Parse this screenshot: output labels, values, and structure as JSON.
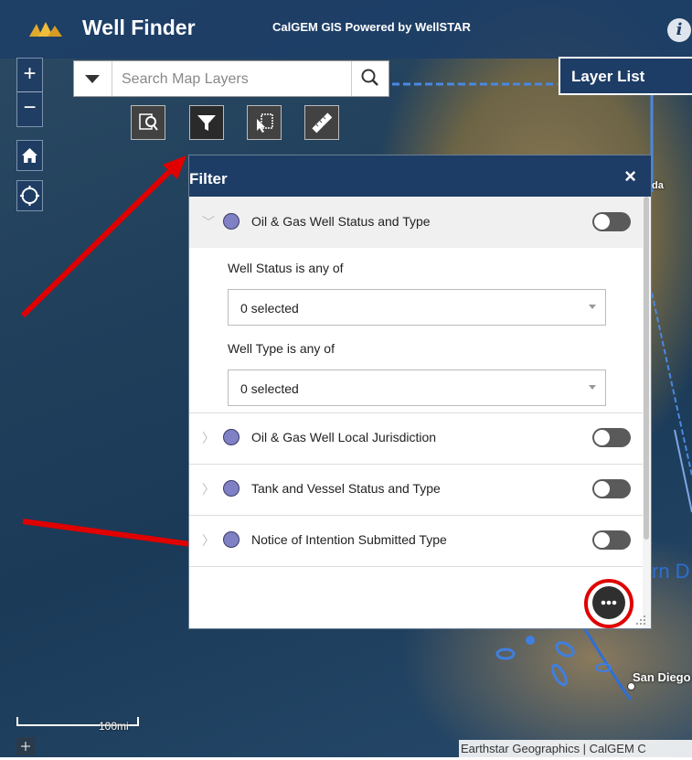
{
  "header": {
    "title": "Well Finder",
    "subtitle": "CalGEM GIS Powered by WellSTAR",
    "info_icon": "i"
  },
  "map_controls": {
    "zoom_in": "+",
    "zoom_out": "−",
    "home_icon": "home-icon",
    "locate_icon": "locate-icon"
  },
  "search": {
    "placeholder": "Search Map Layers"
  },
  "toolbar": {
    "tools": [
      "query-icon",
      "filter-icon",
      "select-icon",
      "measure-icon"
    ]
  },
  "layer_list": {
    "label": "Layer List"
  },
  "filter_panel": {
    "title": "Filter",
    "close_label": "×",
    "layers": [
      {
        "label": "Oil & Gas Well Status and Type",
        "expanded": true,
        "enabled": false
      },
      {
        "label": "Oil & Gas Well Local Jurisdiction",
        "expanded": false,
        "enabled": false
      },
      {
        "label": "Tank and Vessel Status and Type",
        "expanded": false,
        "enabled": false
      },
      {
        "label": "Notice of Intention Submitted Type",
        "expanded": false,
        "enabled": false
      }
    ],
    "well_status": {
      "label": "Well Status is any of",
      "value": "0 selected"
    },
    "well_type": {
      "label": "Well Type is any of",
      "value": "0 selected"
    },
    "more_label": "•••"
  },
  "map_labels": {
    "city": "San Diego",
    "partial_label": "rn D",
    "scale": "100mi",
    "attribution": "Earthstar Geographics | CalGEM C",
    "partial_top": "da"
  },
  "colors": {
    "header": "#1d3d66",
    "layer_dot": "#8080c4",
    "annotation": "#e00000"
  }
}
